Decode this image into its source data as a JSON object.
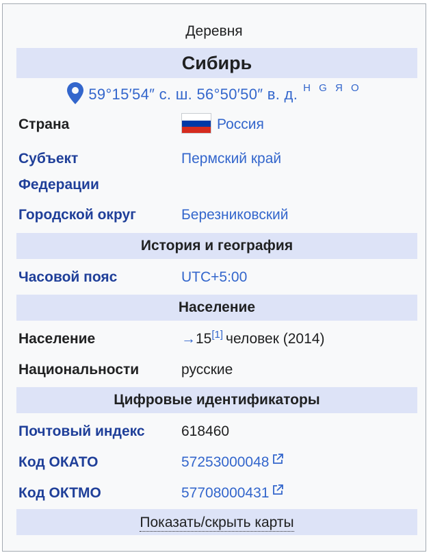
{
  "infobox": {
    "caption": "Деревня",
    "title": "Сибирь",
    "coordinates": {
      "text": "59°15′54″ с. ш. 56°50′50″ в. д.",
      "map_links": "H G Я O"
    },
    "rows": {
      "country": {
        "label": "Страна",
        "value": "Россия",
        "flag_colors": [
          "#ffffff",
          "#0039a6",
          "#d52b1e"
        ]
      },
      "federal_subject": {
        "label_line1": "Субъект",
        "label_line2": "Федерации",
        "value": "Пермский край"
      },
      "urban_district": {
        "label": "Городской округ",
        "value": "Березниковский"
      },
      "timezone": {
        "label": "Часовой пояс",
        "value": "UTC+5:00"
      },
      "population": {
        "label": "Население",
        "arrow": "→",
        "number": "15",
        "ref": "[1]",
        "rest": "человек (2014)"
      },
      "nationalities": {
        "label": "Национальности",
        "value": "русские"
      },
      "postal_code": {
        "label": "Почтовый индекс",
        "value": "618460"
      },
      "okato": {
        "label": "Код ОКАТО",
        "value": "57253000048"
      },
      "oktmo": {
        "label": "Код ОКТМО",
        "value": "57708000431"
      }
    },
    "sections": {
      "history": "История и география",
      "population": "Население",
      "identifiers": "Цифровые идентификаторы"
    },
    "toggle_maps": "Показать/скрыть карты"
  },
  "colors": {
    "header_band": "#dde3f7",
    "link": "#3366cc",
    "label_link": "#1f3f99",
    "background": "#f8f9fa"
  }
}
